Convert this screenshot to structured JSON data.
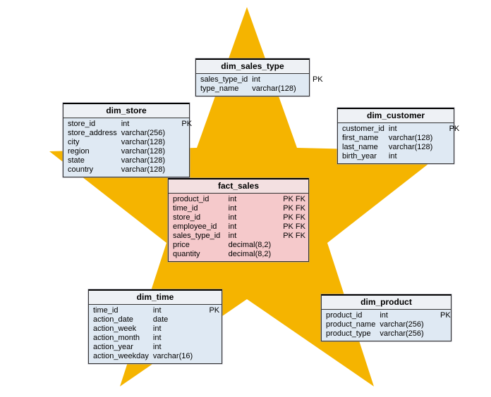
{
  "star_color": "#f5b400",
  "tables": {
    "sales_type": {
      "title": "dim_sales_type",
      "rows": [
        {
          "name": "sales_type_id",
          "type": "int",
          "key": "PK"
        },
        {
          "name": "type_name",
          "type": "varchar(128)",
          "key": ""
        }
      ]
    },
    "store": {
      "title": "dim_store",
      "rows": [
        {
          "name": "store_id",
          "type": "int",
          "key": "PK"
        },
        {
          "name": "store_address",
          "type": "varchar(256)",
          "key": ""
        },
        {
          "name": "city",
          "type": "varchar(128)",
          "key": ""
        },
        {
          "name": "region",
          "type": "varchar(128)",
          "key": ""
        },
        {
          "name": "state",
          "type": "varchar(128)",
          "key": ""
        },
        {
          "name": "country",
          "type": "varchar(128)",
          "key": ""
        }
      ]
    },
    "customer": {
      "title": "dim_customer",
      "rows": [
        {
          "name": "customer_id",
          "type": "int",
          "key": "PK"
        },
        {
          "name": "first_name",
          "type": "varchar(128)",
          "key": ""
        },
        {
          "name": "last_name",
          "type": "varchar(128)",
          "key": ""
        },
        {
          "name": "birth_year",
          "type": "int",
          "key": ""
        }
      ]
    },
    "fact": {
      "title": "fact_sales",
      "rows": [
        {
          "name": "product_id",
          "type": "int",
          "key": "PK FK"
        },
        {
          "name": "time_id",
          "type": "int",
          "key": "PK FK"
        },
        {
          "name": "store_id",
          "type": "int",
          "key": "PK FK"
        },
        {
          "name": "employee_id",
          "type": "int",
          "key": "PK FK"
        },
        {
          "name": "sales_type_id",
          "type": "int",
          "key": "PK FK"
        },
        {
          "name": "price",
          "type": "decimal(8,2)",
          "key": ""
        },
        {
          "name": "quantity",
          "type": "decimal(8,2)",
          "key": ""
        }
      ]
    },
    "time": {
      "title": "dim_time",
      "rows": [
        {
          "name": "time_id",
          "type": "int",
          "key": "PK"
        },
        {
          "name": "action_date",
          "type": "date",
          "key": ""
        },
        {
          "name": "action_week",
          "type": "int",
          "key": ""
        },
        {
          "name": "action_month",
          "type": "int",
          "key": ""
        },
        {
          "name": "action_year",
          "type": "int",
          "key": ""
        },
        {
          "name": "action_weekday",
          "type": "varchar(16)",
          "key": ""
        }
      ]
    },
    "product": {
      "title": "dim_product",
      "rows": [
        {
          "name": "product_id",
          "type": "int",
          "key": "PK"
        },
        {
          "name": "product_name",
          "type": "varchar(256)",
          "key": ""
        },
        {
          "name": "product_type",
          "type": "varchar(256)",
          "key": ""
        }
      ]
    }
  }
}
